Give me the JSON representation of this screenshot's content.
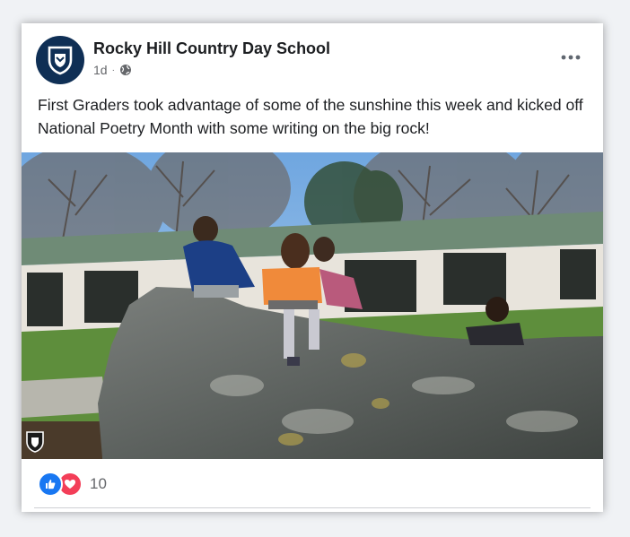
{
  "post": {
    "author": "Rocky Hill Country Day School",
    "time": "1d",
    "separator": "·",
    "audience_icon": "globe-icon",
    "more_icon": "more-options-icon",
    "text": "First Graders took advantage of some of the sunshine this week and kicked off National Poetry Month with some writing on the big rock!",
    "photo_icon": "school-logo-watermark-icon"
  },
  "reactions": {
    "types": [
      "like",
      "love"
    ],
    "count": "10"
  },
  "colors": {
    "brand_navy": "#0f2f55",
    "like_blue": "#1877f2",
    "love_red": "#f33e58",
    "text_primary": "#1c1e21",
    "text_secondary": "#65676b"
  }
}
